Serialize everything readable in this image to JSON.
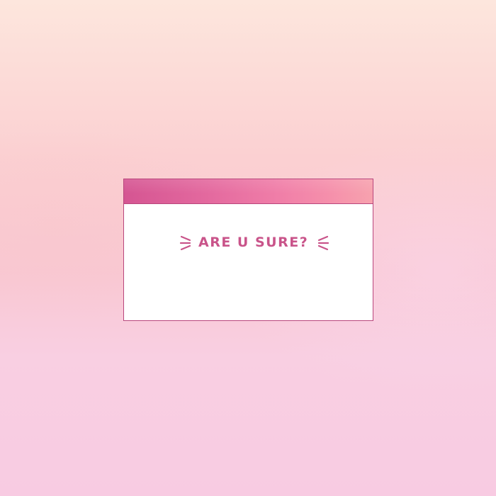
{
  "dialog": {
    "message": "ARE U SURE?"
  },
  "colors": {
    "accent": "#d55592",
    "border": "#b9467c",
    "text": "#c9548a",
    "background_top": "#fde6dd",
    "background_bottom": "#f8cbe2"
  },
  "icons": {
    "left_decoration": "sparkle-lines-icon",
    "right_decoration": "sparkle-lines-icon"
  }
}
